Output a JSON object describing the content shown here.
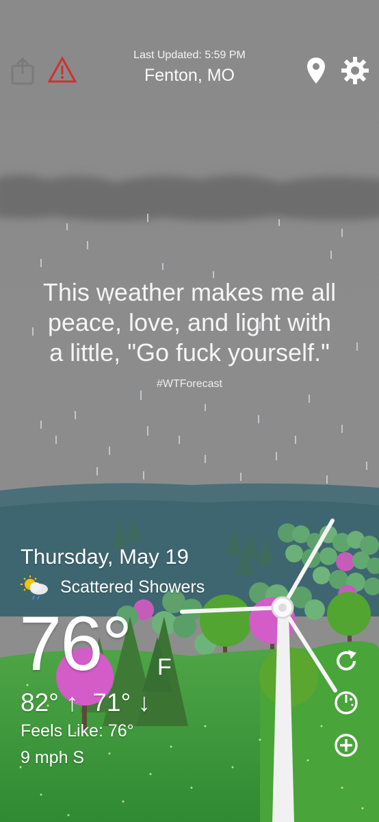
{
  "header": {
    "last_updated": "Last Updated: 5:59 PM",
    "location": "Fenton, MO",
    "share_icon": "share-icon",
    "alert_icon": "warning-triangle-icon",
    "location_icon": "map-pin-icon",
    "settings_icon": "gear-icon"
  },
  "quote": {
    "line1": "This weather makes me all",
    "line2": "peace, love, and light with",
    "line3": "a little, \"Go fuck yourself.\"",
    "hashtag": "#WTForecast"
  },
  "weather": {
    "date": "Thursday, May 19",
    "condition_icon": "sun-cloud-rain-icon",
    "condition": "Scattered Showers",
    "temperature": "76°",
    "unit": "F",
    "hi_lo": "82° ↑  71° ↓",
    "feels_like": "Feels Like: 76°",
    "wind": "9 mph S"
  },
  "side_controls": {
    "refresh_icon": "refresh-icon",
    "radar_icon": "radar-icon",
    "add_icon": "plus-circle-icon"
  },
  "colors": {
    "sky": "#8a8a8a",
    "hills": "#3f6b76",
    "grass": "#3f9a3a",
    "pink_tree": "#d25fc4",
    "alert_red": "#d0312d"
  }
}
